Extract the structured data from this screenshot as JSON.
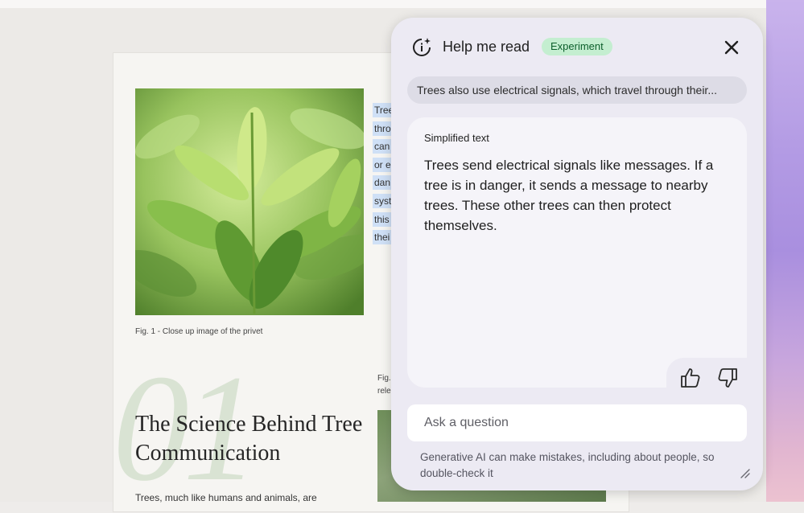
{
  "document": {
    "figure1_caption": "Fig. 1 - Close up image of the privet",
    "section_number": "01",
    "section_heading": "The Science Behind Tree Communication",
    "body_snippet": "Trees, much like humans and animals, are",
    "selected_line_fragments": [
      "Tree",
      "thro",
      "can",
      "or e",
      "dan",
      "syst",
      "this",
      "thei"
    ],
    "figure2_caption_fragment": "Fig. rele"
  },
  "panel": {
    "header_icon": "sparkle-info-icon",
    "title": "Help me read",
    "badge": "Experiment",
    "close_icon": "close-icon",
    "selected_text": "Trees also use electrical signals, which travel through their...",
    "simplified_label": "Simplified text",
    "simplified_body": "Trees send electrical signals like messages. If a tree is in danger, it sends a message to nearby trees. These other trees can then protect themselves.",
    "feedback": {
      "thumbs_up_icon": "thumbs-up-icon",
      "thumbs_down_icon": "thumbs-down-icon"
    },
    "ask_placeholder": "Ask a question",
    "disclaimer": "Generative AI can make mistakes, including about people, so double-check it",
    "resize_icon": "resize-handle-icon"
  },
  "colors": {
    "panel_bg": "#eceaf3",
    "card_bg": "#f5f4f9",
    "badge_bg": "#c4eed0",
    "badge_text": "#0d5f2c",
    "selection_highlight": "#cfe0f6"
  }
}
